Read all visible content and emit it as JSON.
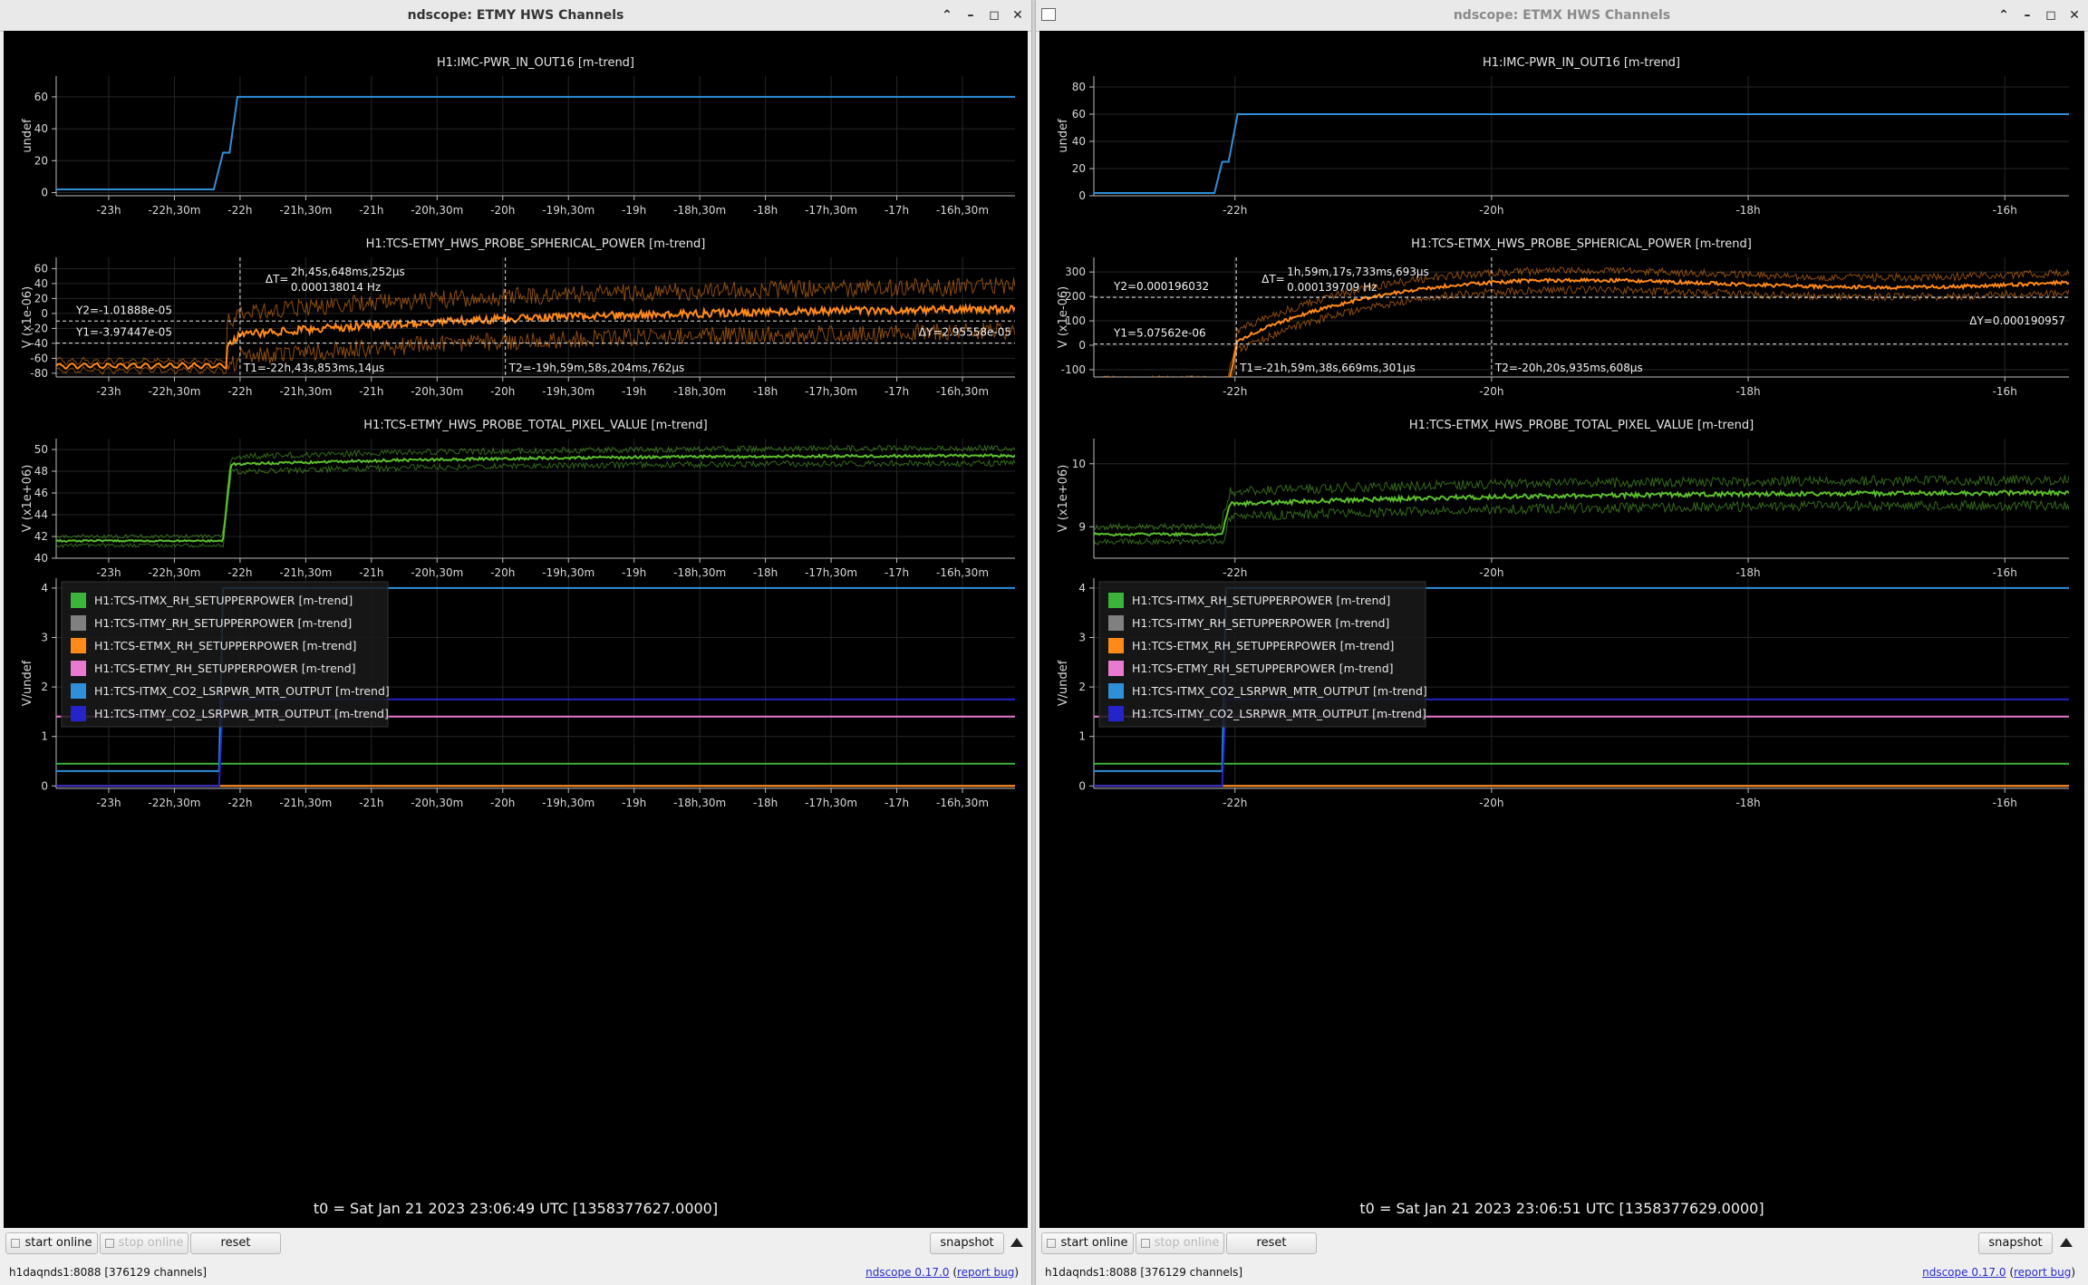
{
  "windows": [
    {
      "title": "ndscope: ETMY HWS Channels",
      "active": true,
      "t0": "t0 = Sat Jan 21 2023 23:06:49 UTC [1358377627.0000]",
      "toolbar": {
        "start": "start online",
        "stop": "stop online",
        "reset": "reset",
        "snapshot": "snapshot"
      },
      "status": {
        "server": "h1daqnds1:8088  [376129 channels]",
        "version": "ndscope 0.17.0",
        "report_bug": "report bug"
      },
      "x_ticks": [
        "-23h",
        "-22h,30m",
        "-22h",
        "-21h,30m",
        "-21h",
        "-20h,30m",
        "-20h",
        "-19h,30m",
        "-19h",
        "-18h,30m",
        "-18h",
        "-17h,30m",
        "-17h",
        "-16h,30m"
      ],
      "x_ticks_t": [
        -23,
        -22.5,
        -22,
        -21.5,
        -21,
        -20.5,
        -20,
        -19.5,
        -19,
        -18.5,
        -18,
        -17.5,
        -17,
        -16.5
      ],
      "xlim": [
        -23.4,
        -16.1
      ],
      "plots": [
        {
          "title": "H1:IMC-PWR_IN_OUT16 [m-trend]",
          "ylabel": "undef",
          "ylim": [
            -2,
            73
          ],
          "yticks": [
            0,
            20,
            40,
            60
          ],
          "series": [
            {
              "color": "#2f8fd8",
              "kind": "step",
              "points": [
                [
                  -23.4,
                  2
                ],
                [
                  -22.2,
                  2
                ],
                [
                  -22.13,
                  25
                ],
                [
                  -22.08,
                  25
                ],
                [
                  -22.02,
                  60
                ],
                [
                  -16.1,
                  60
                ]
              ]
            }
          ]
        },
        {
          "title": "H1:TCS-ETMY_HWS_PROBE_SPHERICAL_POWER [m-trend]",
          "ylabel": "V (x1e-06)",
          "ylim": [
            -85,
            75
          ],
          "yticks": [
            -80,
            -60,
            -40,
            -20,
            0,
            20,
            40,
            60
          ],
          "series": [
            {
              "color": "#ff8a1a",
              "kind": "sph",
              "rise_t": -22.1,
              "base": -70,
              "end": 10,
              "spike": -30,
              "band": 30
            }
          ],
          "cursors": {
            "t1": -22.0,
            "t2": -19.98,
            "y1": -39.7,
            "y2": -10.2,
            "t1_label": "T1=-22h,43s,853ms,14µs",
            "t2_label": "T2=-19h,59m,58s,204ms,762µs",
            "y1_label": "Y1=-3.97447e-05",
            "y2_label": "Y2=-1.01888e-05",
            "dy_label": "ΔY=2.95558e-05",
            "dt_prefix": "ΔT=",
            "dt_label": "2h,45s,648ms,252µs",
            "df_label": "0.000138014 Hz"
          }
        },
        {
          "title": "H1:TCS-ETMY_HWS_PROBE_TOTAL_PIXEL_VALUE [m-trend]",
          "ylabel": "V (x1e+06)",
          "ylim": [
            40,
            51
          ],
          "yticks": [
            40,
            42,
            44,
            46,
            48,
            50
          ],
          "series": [
            {
              "color": "#5cc02c",
              "kind": "pix",
              "rise_t": -22.13,
              "base": 41.6,
              "end": 49.5,
              "band": 0.7,
              "plateau": 48.6
            }
          ]
        },
        {
          "title": "",
          "ylabel": "V/undef",
          "ylim": [
            -0.05,
            4.2
          ],
          "yticks": [
            0,
            1,
            2,
            3,
            4
          ],
          "legend": true,
          "series": [
            {
              "name": "H1:TCS-ITMX_RH_SETUPPERPOWER [m-trend]",
              "color": "#3cb43c",
              "kind": "step",
              "points": [
                [
                  -23.4,
                  0.45
                ],
                [
                  -16.1,
                  0.45
                ]
              ]
            },
            {
              "name": "H1:TCS-ITMY_RH_SETUPPERPOWER [m-trend]",
              "color": "#808080",
              "kind": "step",
              "points": [
                [
                  -23.4,
                  0
                ],
                [
                  -16.1,
                  0
                ]
              ]
            },
            {
              "name": "H1:TCS-ETMX_RH_SETUPPERPOWER [m-trend]",
              "color": "#ff8a1a",
              "kind": "step",
              "points": [
                [
                  -23.4,
                  0
                ],
                [
                  -16.1,
                  0
                ]
              ]
            },
            {
              "name": "H1:TCS-ETMY_RH_SETUPPERPOWER [m-trend]",
              "color": "#e87ad0",
              "kind": "step",
              "points": [
                [
                  -23.4,
                  1.4
                ],
                [
                  -16.1,
                  1.4
                ]
              ]
            },
            {
              "name": "H1:TCS-ITMX_CO2_LSRPWR_MTR_OUTPUT [m-trend]",
              "color": "#2f8fd8",
              "kind": "step",
              "points": [
                [
                  -23.4,
                  0.3
                ],
                [
                  -22.16,
                  0.3
                ],
                [
                  -22.13,
                  4.0
                ],
                [
                  -16.1,
                  4.0
                ]
              ]
            },
            {
              "name": "H1:TCS-ITMY_CO2_LSRPWR_MTR_OUTPUT [m-trend]",
              "color": "#2424c8",
              "kind": "step",
              "points": [
                [
                  -23.4,
                  0
                ],
                [
                  -22.16,
                  0
                ],
                [
                  -22.13,
                  1.75
                ],
                [
                  -16.1,
                  1.75
                ]
              ]
            }
          ]
        }
      ]
    },
    {
      "title": "ndscope: ETMX HWS Channels",
      "active": false,
      "t0": "t0 = Sat Jan 21 2023 23:06:51 UTC [1358377629.0000]",
      "toolbar": {
        "start": "start online",
        "stop": "stop online",
        "reset": "reset",
        "snapshot": "snapshot"
      },
      "status": {
        "server": "h1daqnds1:8088  [376129 channels]",
        "version": "ndscope 0.17.0",
        "report_bug": "report bug"
      },
      "x_ticks": [
        "-22h",
        "-20h",
        "-18h",
        "-16h"
      ],
      "x_ticks_t": [
        -22,
        -20,
        -18,
        -16
      ],
      "xlim": [
        -23.1,
        -15.5
      ],
      "plots": [
        {
          "title": "H1:IMC-PWR_IN_OUT16 [m-trend]",
          "ylabel": "undef",
          "ylim": [
            0,
            88
          ],
          "yticks": [
            0,
            20,
            40,
            60,
            80
          ],
          "series": [
            {
              "color": "#2f8fd8",
              "kind": "step",
              "points": [
                [
                  -23.1,
                  2
                ],
                [
                  -22.16,
                  2
                ],
                [
                  -22.1,
                  25
                ],
                [
                  -22.05,
                  25
                ],
                [
                  -21.98,
                  60
                ],
                [
                  -15.5,
                  60
                ]
              ]
            }
          ]
        },
        {
          "title": "H1:TCS-ETMX_HWS_PROBE_SPHERICAL_POWER [m-trend]",
          "ylabel": "V (x1e-06)",
          "ylim": [
            -130,
            360
          ],
          "yticks": [
            -100,
            0,
            100,
            200,
            300
          ],
          "series": [
            {
              "color": "#ff8a1a",
              "kind": "sphx",
              "rise_t": -22.05,
              "base": -160,
              "end": 270,
              "band": 40
            }
          ],
          "cursors": {
            "t1": -21.99,
            "t2": -20.0,
            "y1": 5.1,
            "y2": 196,
            "t1_label": "T1=-21h,59m,38s,669ms,301µs",
            "t2_label": "T2=-20h,20s,935ms,608µs",
            "y1_label": "Y1=5.07562e-06",
            "y2_label": "Y2=0.000196032",
            "dy_label": "ΔY=0.000190957",
            "dt_prefix": "ΔT=",
            "dt_label": "1h,59m,17s,733ms,693µs",
            "df_label": "0.000139709 Hz"
          }
        },
        {
          "title": "H1:TCS-ETMX_HWS_PROBE_TOTAL_PIXEL_VALUE [m-trend]",
          "ylabel": "V (x1e+06)",
          "ylim": [
            8.5,
            10.4
          ],
          "yticks": [
            9,
            10
          ],
          "series": [
            {
              "color": "#5cc02c",
              "kind": "pix",
              "rise_t": -22.1,
              "base": 8.88,
              "end": 9.55,
              "band": 0.2,
              "plateau": 9.35
            }
          ]
        },
        {
          "title": "",
          "ylabel": "V/undef",
          "ylim": [
            -0.05,
            4.2
          ],
          "yticks": [
            0,
            1,
            2,
            3,
            4
          ],
          "legend": true,
          "series": [
            {
              "name": "H1:TCS-ITMX_RH_SETUPPERPOWER [m-trend]",
              "color": "#3cb43c",
              "kind": "step",
              "points": [
                [
                  -23.1,
                  0.45
                ],
                [
                  -15.5,
                  0.45
                ]
              ]
            },
            {
              "name": "H1:TCS-ITMY_RH_SETUPPERPOWER [m-trend]",
              "color": "#808080",
              "kind": "step",
              "points": [
                [
                  -23.1,
                  0
                ],
                [
                  -15.5,
                  0
                ]
              ]
            },
            {
              "name": "H1:TCS-ETMX_RH_SETUPPERPOWER [m-trend]",
              "color": "#ff8a1a",
              "kind": "step",
              "points": [
                [
                  -23.1,
                  0
                ],
                [
                  -15.5,
                  0
                ]
              ]
            },
            {
              "name": "H1:TCS-ETMY_RH_SETUPPERPOWER [m-trend]",
              "color": "#e87ad0",
              "kind": "step",
              "points": [
                [
                  -23.1,
                  1.4
                ],
                [
                  -15.5,
                  1.4
                ]
              ]
            },
            {
              "name": "H1:TCS-ITMX_CO2_LSRPWR_MTR_OUTPUT [m-trend]",
              "color": "#2f8fd8",
              "kind": "step",
              "points": [
                [
                  -23.1,
                  0.3
                ],
                [
                  -22.1,
                  0.3
                ],
                [
                  -22.07,
                  4.0
                ],
                [
                  -15.5,
                  4.0
                ]
              ]
            },
            {
              "name": "H1:TCS-ITMY_CO2_LSRPWR_MTR_OUTPUT [m-trend]",
              "color": "#2424c8",
              "kind": "step",
              "points": [
                [
                  -23.1,
                  0
                ],
                [
                  -22.1,
                  0
                ],
                [
                  -22.07,
                  1.75
                ],
                [
                  -15.5,
                  1.75
                ]
              ]
            }
          ]
        }
      ]
    }
  ]
}
